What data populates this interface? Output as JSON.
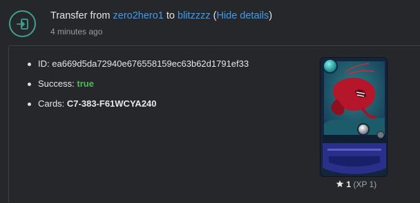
{
  "header": {
    "prefix": "Transfer from",
    "from_user": "zero2hero1",
    "connector": "to",
    "to_user": "blitzzzz",
    "hide_details": "Hide details",
    "timestamp": "4 minutes ago",
    "icon": "transfer-in-icon"
  },
  "details": {
    "id_label": "ID:",
    "id_value": "ea669d5da72940e676558159ec63b62d1791ef33",
    "success_label": "Success:",
    "success_value": "true",
    "cards_label": "Cards:",
    "cards_value": "C7-383-F61WCYA240"
  },
  "card": {
    "level": "1",
    "xp": "(XP 1)",
    "star_icon": "star-icon"
  },
  "colors": {
    "accent": "#3fa294",
    "link": "#3f9cf0",
    "success": "#4fbe57"
  }
}
